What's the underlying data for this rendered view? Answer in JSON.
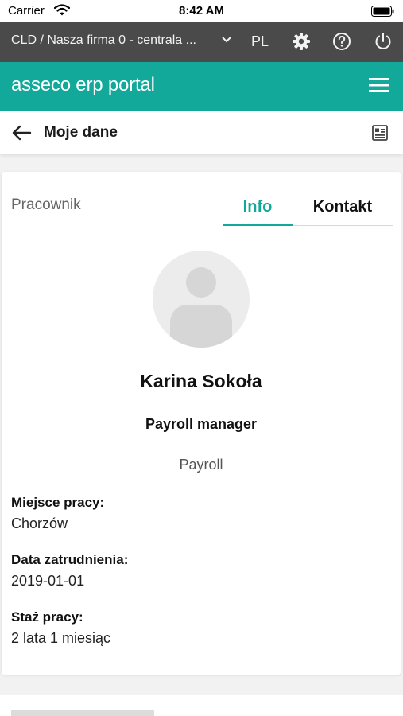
{
  "status": {
    "carrier": "Carrier",
    "time": "8:42 AM"
  },
  "topbar": {
    "company": "CLD / Nasza firma 0 - centrala ...",
    "lang": "PL"
  },
  "brand": {
    "name": "asseco erp portal",
    "color": "#12a89a"
  },
  "page": {
    "title": "Moje dane"
  },
  "card": {
    "section_label": "Pracownik",
    "tabs": [
      {
        "label": "Info",
        "active": true
      },
      {
        "label": "Kontakt",
        "active": false
      }
    ]
  },
  "employee": {
    "name": "Karina Sokoła",
    "role": "Payroll manager",
    "department": "Payroll"
  },
  "fields": [
    {
      "label": "Miejsce pracy:",
      "value": "Chorzów"
    },
    {
      "label": "Data zatrudnienia:",
      "value": "2019-01-01"
    },
    {
      "label": "Staż pracy:",
      "value": "2 lata 1 miesiąc"
    }
  ],
  "icons": {
    "wifi": "wifi-icon",
    "battery": "battery-icon",
    "company_dropdown": "chevron-down-icon",
    "settings": "gear-icon",
    "help": "help-circle-icon",
    "logout": "power-icon",
    "menu": "hamburger-menu-icon",
    "back": "arrow-left-icon",
    "view_toggle": "card-view-icon",
    "avatar": "person-placeholder-icon"
  }
}
